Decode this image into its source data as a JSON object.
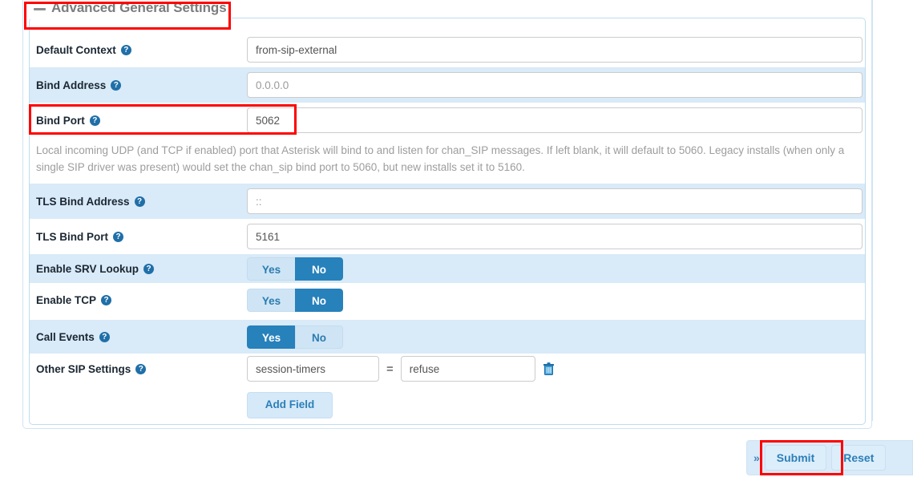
{
  "section": {
    "title": "Advanced General Settings",
    "collapse_icon": "minus-icon"
  },
  "fields": [
    {
      "label": "Default Context",
      "help_icon": "help-circle-icon",
      "type": "text",
      "value": "from-sip-external",
      "placeholder": "",
      "striped": false
    },
    {
      "label": "Bind Address",
      "help_icon": "help-circle-icon",
      "type": "text",
      "value": "",
      "placeholder": "0.0.0.0",
      "striped": true
    },
    {
      "label": "Bind Port",
      "help_icon": "help-circle-icon",
      "type": "text",
      "value": "5062",
      "placeholder": "",
      "striped": false,
      "description": "Local incoming UDP (and TCP if enabled) port that Asterisk will bind to and listen for chan_SIP messages. If left blank, it will default to 5060. Legacy installs (when only a single SIP driver was present) would set the chan_sip bind port to 5060, but new installs set it to 5160."
    },
    {
      "label": "TLS Bind Address",
      "help_icon": "help-circle-icon",
      "type": "text",
      "value": "",
      "placeholder": "::",
      "striped": true
    },
    {
      "label": "TLS Bind Port",
      "help_icon": "help-circle-icon",
      "type": "text",
      "value": "5161",
      "placeholder": "",
      "striped": false
    },
    {
      "label": "Enable SRV Lookup",
      "help_icon": "help-circle-icon",
      "type": "toggle",
      "options": [
        "Yes",
        "No"
      ],
      "selected": "No",
      "striped": true
    },
    {
      "label": "Enable TCP",
      "help_icon": "help-circle-icon",
      "type": "toggle",
      "options": [
        "Yes",
        "No"
      ],
      "selected": "No",
      "striped": false
    },
    {
      "label": "Call Events",
      "help_icon": "help-circle-icon",
      "type": "toggle",
      "options": [
        "Yes",
        "No"
      ],
      "selected": "Yes",
      "striped": true
    },
    {
      "label": "Other SIP Settings",
      "help_icon": "help-circle-icon",
      "type": "keyvalue",
      "key": "session-timers",
      "equals": "=",
      "val": "refuse",
      "delete_icon": "trash-icon",
      "striped": false
    }
  ],
  "add_field_button": "Add Field",
  "toolbar": {
    "expand_icon": "»",
    "submit_label": "Submit",
    "reset_label": "Reset"
  },
  "colors": {
    "accent_blue": "#2781bb",
    "toggle_off_bg": "#cfe5f5",
    "row_stripe": "#d9eaf8",
    "highlight_red": "#fe0000",
    "label_text": "#1b2733",
    "help_text": "#9d9d9d"
  }
}
